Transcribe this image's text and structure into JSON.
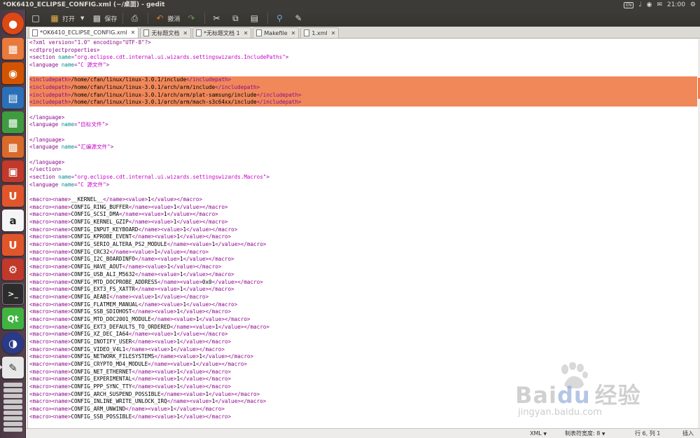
{
  "window_title": "*OK6410_ECLIPSE_CONFIG.xml (~/桌面) - gedit",
  "panel": {
    "kbd_label": "EN",
    "time": "21:00"
  },
  "toolbar": {
    "open_label": "打开",
    "save_label": "保存",
    "undo_label": "撤消"
  },
  "tabs": [
    {
      "label": "*OK6410_ECLIPSE_CONFIG.xml"
    },
    {
      "label": "无标题文档"
    },
    {
      "label": "*无标题文档 1"
    },
    {
      "label": "Makefile"
    },
    {
      "label": "1.xml"
    }
  ],
  "status": {
    "language": "XML",
    "tab_width": "制表符宽度: 8",
    "position": "行 6, 列 1",
    "mode": "插入"
  },
  "watermark": {
    "brand": "Bai",
    "brand2": "du",
    "brand3": "经验",
    "url": "jingyan.baidu.com"
  },
  "colors": {
    "selection": "#f0885a",
    "tag": "#8b0a8b",
    "attr": "#008c8c",
    "value": "#c600c6"
  },
  "code_lines": [
    {
      "t": "pi",
      "text": "<?xml version=\"1.0\" encoding=\"UTF-8\"?>"
    },
    {
      "t": "tag",
      "text": "<cdtprojectproperties>"
    },
    {
      "t": "attr",
      "tag": "section",
      "attr": "name",
      "val": "org.eclipse.cdt.internal.ui.wizards.settingswizards.IncludePaths"
    },
    {
      "t": "attr",
      "tag": "language",
      "attr": "name",
      "val": "C 源文件"
    },
    {
      "t": "blank"
    },
    {
      "t": "elem",
      "tag": "includepath",
      "text": "/home/cfan/linux/linux-3.0.1/include",
      "hl": true
    },
    {
      "t": "elem",
      "tag": "includepath",
      "text": "/home/cfan/linux/linux-3.0.1/arch/arm/include",
      "hl": true
    },
    {
      "t": "elem",
      "tag": "includepath",
      "text": "/home/cfan/linux/linux-3.0.1/arch/arm/plat-samsung/include",
      "hl": true
    },
    {
      "t": "elem",
      "tag": "includepath",
      "text": "/home/cfan/linux/linux-3.0.1/arch/arm/mach-s3c64xx/include",
      "hl": true
    },
    {
      "t": "blank"
    },
    {
      "t": "tag",
      "text": "</language>"
    },
    {
      "t": "attr",
      "tag": "language",
      "attr": "name",
      "val": "目标文件"
    },
    {
      "t": "blank"
    },
    {
      "t": "tag",
      "text": "</language>"
    },
    {
      "t": "attr",
      "tag": "language",
      "attr": "name",
      "val": "汇编源文件"
    },
    {
      "t": "blank"
    },
    {
      "t": "tag",
      "text": "</language>"
    },
    {
      "t": "tag",
      "text": "</section>"
    },
    {
      "t": "attr",
      "tag": "section",
      "attr": "name",
      "val": "org.eclipse.cdt.internal.ui.wizards.settingswizards.Macros"
    },
    {
      "t": "attr",
      "tag": "language",
      "attr": "name",
      "val": "C 源文件"
    },
    {
      "t": "blank"
    },
    {
      "t": "macro",
      "name": "__KERNEL__",
      "value": "1"
    },
    {
      "t": "macro",
      "name": "CONFIG_RING_BUFFER",
      "value": "1"
    },
    {
      "t": "macro",
      "name": "CONFIG_SCSI_DMA",
      "value": "1"
    },
    {
      "t": "macro",
      "name": "CONFIG_KERNEL_GZIP",
      "value": "1"
    },
    {
      "t": "macro",
      "name": "CONFIG_INPUT_KEYBOARD",
      "value": "1"
    },
    {
      "t": "macro",
      "name": "CONFIG_KPROBE_EVENT",
      "value": "1"
    },
    {
      "t": "macro",
      "name": "CONFIG_SERIO_ALTERA_PS2_MODULE",
      "value": "1"
    },
    {
      "t": "macro",
      "name": "CONFIG_CRC32",
      "value": "1"
    },
    {
      "t": "macro",
      "name": "CONFIG_I2C_BOARDINFO",
      "value": "1"
    },
    {
      "t": "macro",
      "name": "CONFIG_HAVE_AOUT",
      "value": "1"
    },
    {
      "t": "macro",
      "name": "CONFIG_USB_ALI_M5632",
      "value": "1"
    },
    {
      "t": "macro",
      "name": "CONFIG_MTD_DOCPROBE_ADDRESS",
      "value": "0x0"
    },
    {
      "t": "macro",
      "name": "CONFIG_EXT3_FS_XATTR",
      "value": "1"
    },
    {
      "t": "macro",
      "name": "CONFIG_AEABI",
      "value": "1"
    },
    {
      "t": "macro",
      "name": "CONFIG_FLATMEM_MANUAL",
      "value": "1"
    },
    {
      "t": "macro",
      "name": "CONFIG_SSB_SDIOHOST",
      "value": "1"
    },
    {
      "t": "macro",
      "name": "CONFIG_MTD_DOC2001_MODULE",
      "value": "1"
    },
    {
      "t": "macro",
      "name": "CONFIG_EXT3_DEFAULTS_TO_ORDERED",
      "value": "1"
    },
    {
      "t": "macro",
      "name": "CONFIG_XZ_DEC_IA64",
      "value": "1"
    },
    {
      "t": "macro",
      "name": "CONFIG_INOTIFY_USER",
      "value": "1"
    },
    {
      "t": "macro",
      "name": "CONFIG_VIDEO_V4L1",
      "value": "1"
    },
    {
      "t": "macro",
      "name": "CONFIG_NETWORK_FILESYSTEMS",
      "value": "1"
    },
    {
      "t": "macro",
      "name": "CONFIG_CRYPTO_MD4_MODULE",
      "value": "1"
    },
    {
      "t": "macro",
      "name": "CONFIG_NET_ETHERNET",
      "value": "1"
    },
    {
      "t": "macro",
      "name": "CONFIG_EXPERIMENTAL",
      "value": "1"
    },
    {
      "t": "macro",
      "name": "CONFIG_PPP_SYNC_TTY",
      "value": "1"
    },
    {
      "t": "macro",
      "name": "CONFIG_ARCH_SUSPEND_POSSIBLE",
      "value": "1"
    },
    {
      "t": "macro",
      "name": "CONFIG_INLINE_WRITE_UNLOCK_IRQ",
      "value": "1"
    },
    {
      "t": "macro",
      "name": "CONFIG_ARM_UNWIND",
      "value": "1"
    },
    {
      "t": "macro",
      "name": "CONFIG_SSB_POSSIBLE",
      "value": "1"
    }
  ]
}
